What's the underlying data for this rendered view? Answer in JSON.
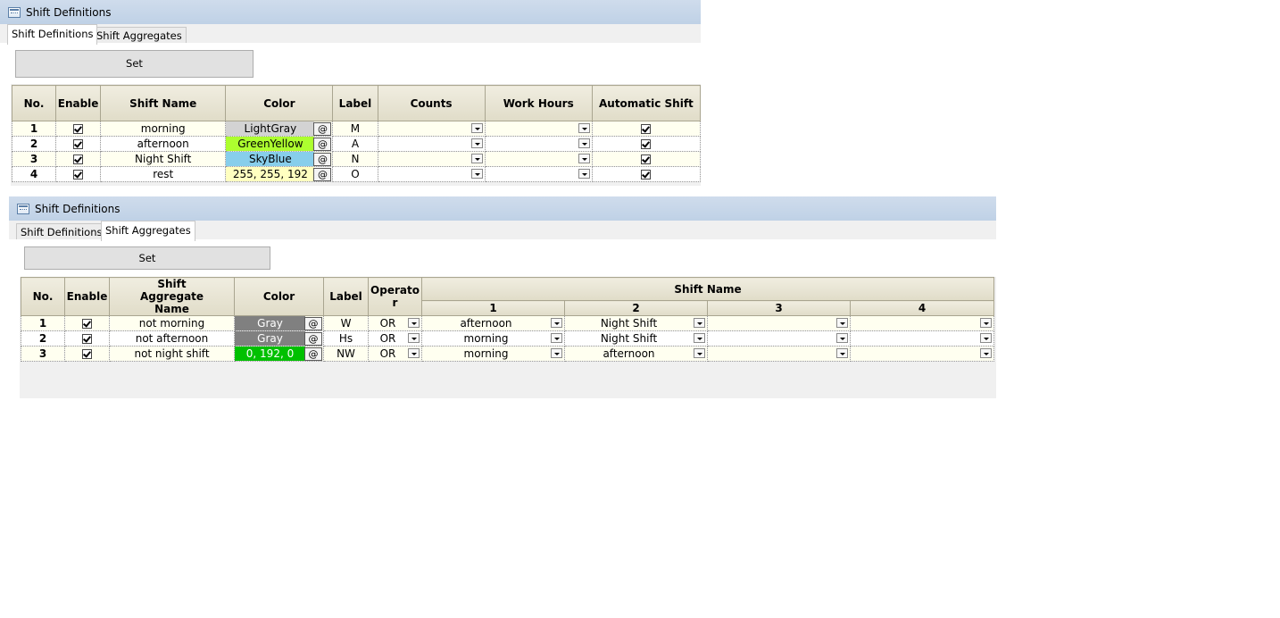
{
  "window1": {
    "title": "Shift Definitions",
    "tabs": [
      {
        "label": "Shift Definitions",
        "active": true
      },
      {
        "label": "Shift Aggregates",
        "active": false
      }
    ],
    "set_label": "Set",
    "columns": [
      "No.",
      "Enable",
      "Shift Name",
      "Color",
      "Label",
      "Counts",
      "Work Hours",
      "Automatic Shift"
    ],
    "rows": [
      {
        "no": "1",
        "enable": true,
        "name": "morning",
        "color": "LightGray",
        "color_hex": "#d3d3d3",
        "label": "M",
        "counts": "",
        "work_hours": "",
        "auto": true
      },
      {
        "no": "2",
        "enable": true,
        "name": "afternoon",
        "color": "GreenYellow",
        "color_hex": "#adff2f",
        "label": "A",
        "counts": "",
        "work_hours": "",
        "auto": true
      },
      {
        "no": "3",
        "enable": true,
        "name": "Night Shift",
        "color": "SkyBlue",
        "color_hex": "#87ceeb",
        "label": "N",
        "counts": "",
        "work_hours": "",
        "auto": true
      },
      {
        "no": "4",
        "enable": true,
        "name": "rest",
        "color": "255, 255, 192",
        "color_hex": "#ffffc0",
        "label": "O",
        "counts": "",
        "work_hours": "",
        "auto": true
      }
    ]
  },
  "window2": {
    "title": "Shift Definitions",
    "tabs": [
      {
        "label": "Shift Definitions",
        "active": false
      },
      {
        "label": "Shift Aggregates",
        "active": true
      }
    ],
    "set_label": "Set",
    "columns": {
      "no": "No.",
      "enable": "Enable",
      "aggregate_name": "Shift Aggregate Name",
      "color": "Color",
      "label": "Label",
      "operator": "Operator",
      "shift_name": "Shift Name",
      "shift_slots": [
        "1",
        "2",
        "3",
        "4"
      ]
    },
    "rows": [
      {
        "no": "1",
        "enable": true,
        "name": "not morning",
        "color": "Gray",
        "color_hex": "#808080",
        "label": "W",
        "operator": "OR",
        "shifts": [
          "afternoon",
          "Night Shift",
          "",
          ""
        ]
      },
      {
        "no": "2",
        "enable": true,
        "name": "not afternoon",
        "color": "Gray",
        "color_hex": "#808080",
        "label": "Hs",
        "operator": "OR",
        "shifts": [
          "morning",
          "Night Shift",
          "",
          ""
        ]
      },
      {
        "no": "3",
        "enable": true,
        "name": "not night shift",
        "color": "0, 192, 0",
        "color_hex": "#00c000",
        "label": "NW",
        "operator": "OR",
        "shifts": [
          "morning",
          "afternoon",
          "",
          ""
        ]
      }
    ]
  },
  "at_label": "@"
}
